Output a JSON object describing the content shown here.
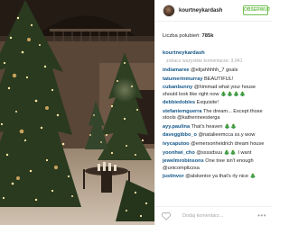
{
  "post": {
    "username": "kourtneykardash",
    "follow_label": "OBSERWUJ",
    "likes_label": "Liczba polubień:",
    "likes_count": "785k",
    "caption_user": "kourtneykardash",
    "view_all": "zobacz wszystkie komentarze: 3,941",
    "comments": [
      {
        "user": "indiamaree",
        "text": "@elijahhhhh_7 goals"
      },
      {
        "user": "tatumerinmurray",
        "text": "BEAUTIFUL!"
      },
      {
        "user": "cubanbunny",
        "text": "@himmad what your house should look like right now 🎄🎄🎄🎄"
      },
      {
        "user": "debbiedobles",
        "text": "Exquisite!"
      },
      {
        "user": "stefaniemguerra",
        "text": "The dream... Except those stools @katherineesterga"
      },
      {
        "user": "ayy.paulina",
        "text": "That's heaven 🎄🎄"
      },
      {
        "user": "daveggibbo_o",
        "text": "@natalieemcca ss.y wow"
      },
      {
        "user": "ivycaputoo",
        "text": "@emersonheidrich dream house"
      },
      {
        "user": "yoonhwi_cho",
        "text": "@ssssdsuu 🎄🎄 I want"
      },
      {
        "user": "jewelmrobinsons",
        "text": "One tree isn't enough @unicomplizzsa"
      },
      {
        "user": "justinvor",
        "text": "@alskentor ya that's rly nice 🎄"
      }
    ],
    "add_comment_placeholder": "Dodaj komentarz...",
    "more_label": "•••"
  },
  "icons": {
    "heart": "heart-icon",
    "more": "more-options-icon"
  },
  "colors": {
    "username_link": "#125688",
    "follow_green": "#70c050",
    "muted_text": "#a5a7aa"
  }
}
